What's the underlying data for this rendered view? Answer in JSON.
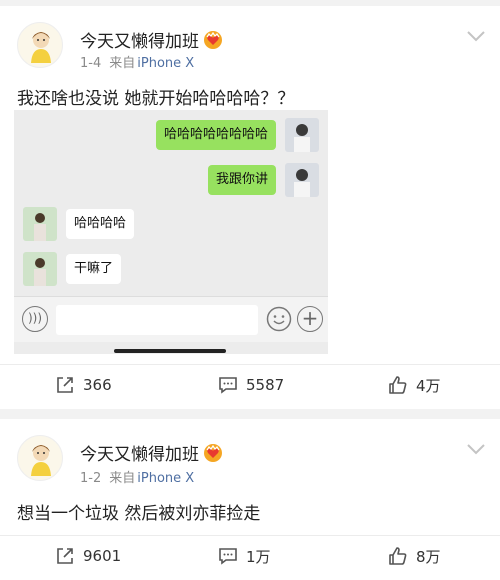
{
  "posts": [
    {
      "username": "今天又懒得加班",
      "date": "1-4",
      "source_prefix": "来自",
      "device": "iPhone X",
      "text": "我还啥也没说 她就开始哈哈哈哈？？",
      "chat": {
        "messages": [
          {
            "side": "right",
            "text": "哈哈哈哈哈哈哈哈"
          },
          {
            "side": "right",
            "text": "我跟你讲"
          },
          {
            "side": "left",
            "text": "哈哈哈哈"
          },
          {
            "side": "left",
            "text": "干嘛了"
          }
        ]
      },
      "actions": {
        "reposts": "366",
        "comments": "5587",
        "likes": "4万"
      }
    },
    {
      "username": "今天又懒得加班",
      "date": "1-2",
      "source_prefix": "来自",
      "device": "iPhone X",
      "text": "想当一个垃圾 然后被刘亦菲捡走",
      "actions": {
        "reposts": "9601",
        "comments": "1万",
        "likes": "8万"
      }
    }
  ],
  "icons": {
    "avatar": "cartoon-girl-avatar",
    "vip": "vip-heart-badge",
    "menu": "chevron-down-icon",
    "repost": "repost-icon",
    "comment": "comment-icon",
    "like": "thumbs-up-icon"
  },
  "colors": {
    "link_blue": "#4f6fa2",
    "chat_green": "#97e15f",
    "vip_orange": "#f5a623"
  }
}
